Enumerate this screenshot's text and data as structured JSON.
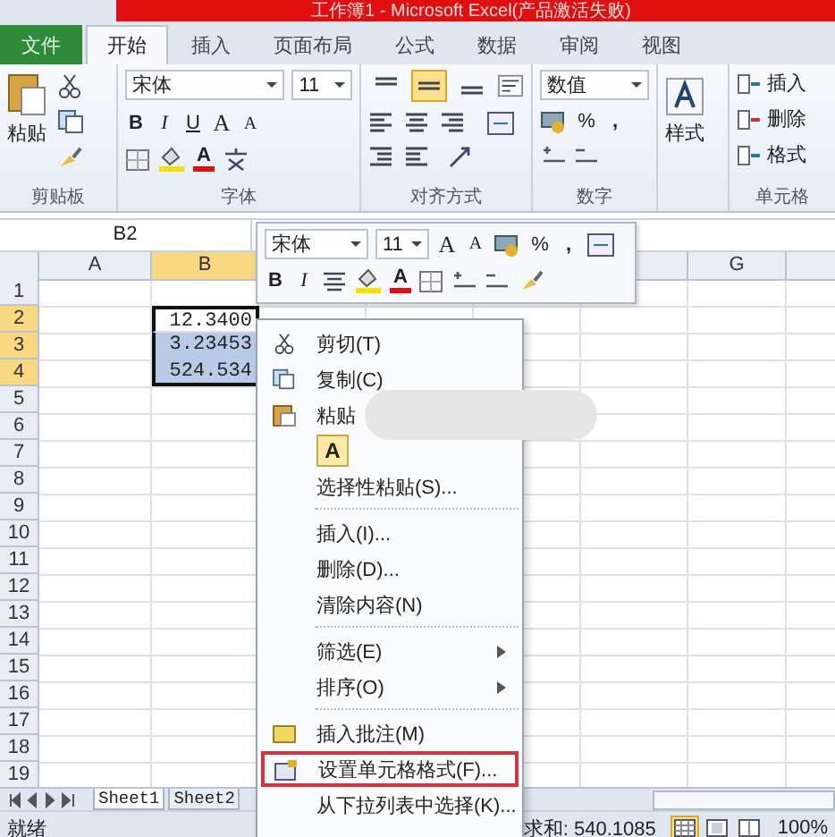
{
  "window": {
    "title": "工作簿1 - Microsoft Excel(产品激活失败)"
  },
  "ribbon_tabs": [
    {
      "label": "文件",
      "kind": "file",
      "selected": false
    },
    {
      "label": "开始",
      "kind": "tab",
      "selected": true
    },
    {
      "label": "插入",
      "kind": "tab",
      "selected": false
    },
    {
      "label": "页面布局",
      "kind": "tab",
      "selected": false
    },
    {
      "label": "公式",
      "kind": "tab",
      "selected": false
    },
    {
      "label": "数据",
      "kind": "tab",
      "selected": false
    },
    {
      "label": "审阅",
      "kind": "tab",
      "selected": false
    },
    {
      "label": "视图",
      "kind": "tab",
      "selected": false
    }
  ],
  "clipboard": {
    "paste": "粘贴",
    "group_label": "剪贴板"
  },
  "font": {
    "name": "宋体",
    "size": "11",
    "bold": "B",
    "italic": "I",
    "underline": "U",
    "grow": "A",
    "shrink": "A",
    "font_color": "A",
    "group_label": "字体"
  },
  "alignment": {
    "group_label": "对齐方式",
    "vertical_align": [
      {
        "selected": false
      },
      {
        "selected": true
      },
      {
        "selected": false
      }
    ]
  },
  "number": {
    "format": "数值",
    "percent": "%",
    "comma": ",",
    "group_label": "数字"
  },
  "styles": {
    "label": "样式"
  },
  "cells": {
    "items": [
      "插入",
      "删除",
      "格式"
    ],
    "group_label": "单元格"
  },
  "formula_bar": {
    "name_box": "B2"
  },
  "sheet": {
    "columns": [
      {
        "kind": "header",
        "label": "A",
        "selected": false
      },
      {
        "kind": "header",
        "label": "B",
        "selected": true
      },
      {
        "kind": "covered"
      },
      {
        "kind": "covered"
      },
      {
        "kind": "covered"
      },
      {
        "kind": "header",
        "selected": false
      },
      {
        "kind": "header",
        "label": "G",
        "selected": false
      },
      {
        "kind": "header",
        "selected": false
      }
    ],
    "rows": [
      {
        "label": "1",
        "selected": false,
        "active": false
      },
      {
        "label": "2",
        "selected": true,
        "active": true,
        "value": "12.3400"
      },
      {
        "label": "3",
        "selected": true,
        "active": false,
        "value": "3.23453"
      },
      {
        "label": "4",
        "selected": true,
        "active": false,
        "value": "524.534"
      },
      {
        "label": "5",
        "selected": false,
        "active": false
      },
      {
        "label": "6",
        "selected": false,
        "active": false
      },
      {
        "label": "7",
        "selected": false,
        "active": false
      },
      {
        "label": "8",
        "selected": false,
        "active": false
      },
      {
        "label": "9",
        "selected": false,
        "active": false
      },
      {
        "label": "10",
        "selected": false,
        "active": false
      },
      {
        "label": "11",
        "selected": false,
        "active": false
      },
      {
        "label": "12",
        "selected": false,
        "active": false
      },
      {
        "label": "13",
        "selected": false,
        "active": false
      },
      {
        "label": "14",
        "selected": false,
        "active": false
      },
      {
        "label": "15",
        "selected": false,
        "active": false
      },
      {
        "label": "16",
        "selected": false,
        "active": false
      },
      {
        "label": "17",
        "selected": false,
        "active": false
      },
      {
        "label": "18",
        "selected": false,
        "active": false
      },
      {
        "label": "19",
        "selected": false,
        "active": false
      }
    ]
  },
  "mini_toolbar": {
    "font": "宋体",
    "size": "11",
    "grow": "A",
    "shrink": "A",
    "percent": "%",
    "comma": ",",
    "bold": "B",
    "italic": "I",
    "font_color": "A"
  },
  "context_menu": {
    "items": [
      {
        "kind": "cut",
        "label": "剪切(T)",
        "selected": false
      },
      {
        "kind": "copy",
        "label": "复制(C)",
        "selected": false
      },
      {
        "kind": "paste",
        "label": "粘贴",
        "selected": false
      },
      {
        "kind": "paste-option",
        "label": "A"
      },
      {
        "kind": "item",
        "label": "选择性粘贴(S)...",
        "selected": false
      },
      {
        "kind": "separator"
      },
      {
        "kind": "item",
        "label": "插入(I)...",
        "selected": false
      },
      {
        "kind": "item",
        "label": "删除(D)...",
        "selected": false
      },
      {
        "kind": "item",
        "label": "清除内容(N)",
        "selected": false
      },
      {
        "kind": "separator"
      },
      {
        "kind": "submenu",
        "label": "筛选(E)",
        "selected": false
      },
      {
        "kind": "submenu",
        "label": "排序(O)",
        "selected": false
      },
      {
        "kind": "separator"
      },
      {
        "kind": "comment",
        "label": "插入批注(M)",
        "selected": false
      },
      {
        "kind": "format",
        "label": "设置单元格格式(F)...",
        "selected": true
      },
      {
        "kind": "item",
        "label": "从下拉列表中选择(K)...",
        "selected": false
      }
    ]
  },
  "sheet_tabs": [
    {
      "label": "Sheet1",
      "selected": true
    },
    {
      "label": "Sheet2",
      "selected": false
    }
  ],
  "status_bar": {
    "mode": "就绪",
    "sum": "求和: 540.1085",
    "zoom": "100%",
    "views": [
      {
        "selected": true
      },
      {
        "selected": false
      },
      {
        "selected": false
      }
    ]
  }
}
